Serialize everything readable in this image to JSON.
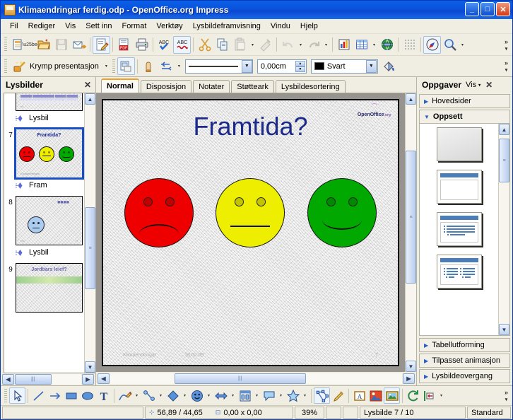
{
  "window": {
    "title": "Klimaendringar ferdig.odp - OpenOffice.org Impress",
    "app_icon": "impress-document-icon",
    "minimize_label": "_",
    "maximize_label": "□",
    "close_label": "✕"
  },
  "menu": {
    "items": [
      {
        "label": "Fil"
      },
      {
        "label": "Rediger"
      },
      {
        "label": "Vis"
      },
      {
        "label": "Sett inn"
      },
      {
        "label": "Format"
      },
      {
        "label": "Verktøy"
      },
      {
        "label": "Lysbildeframvisning"
      },
      {
        "label": "Vindu"
      },
      {
        "label": "Hjelp"
      }
    ]
  },
  "standard_toolbar": {
    "overflow_label": "»",
    "items": [
      {
        "name": "new-document-button",
        "icon": "new-document-icon",
        "dropdown": true
      },
      {
        "name": "open-button",
        "icon": "open-folder-icon"
      },
      {
        "name": "save-button",
        "icon": "floppy-save-icon",
        "disabled": true
      },
      {
        "name": "email-document-button",
        "icon": "envelope-arrow-icon"
      },
      {
        "name": "edit-file-button",
        "icon": "document-pencil-icon",
        "active": true
      },
      {
        "name": "export-pdf-button",
        "icon": "pdf-icon"
      },
      {
        "name": "print-button",
        "icon": "printer-icon"
      },
      {
        "name": "spelling-button",
        "icon": "abc-check-icon"
      },
      {
        "name": "autospellcheck-button",
        "icon": "abc-wave-icon",
        "active": true
      },
      {
        "name": "cut-button",
        "icon": "scissors-icon"
      },
      {
        "name": "copy-button",
        "icon": "copy-pages-icon"
      },
      {
        "name": "paste-button",
        "icon": "clipboard-icon",
        "dropdown": true,
        "disabled": true
      },
      {
        "name": "clone-formatting-button",
        "icon": "paintbrush-icon",
        "disabled": true
      },
      {
        "name": "undo-button",
        "icon": "undo-arrow-icon",
        "dropdown": true,
        "disabled": true
      },
      {
        "name": "redo-button",
        "icon": "redo-arrow-icon",
        "dropdown": true,
        "disabled": true
      },
      {
        "name": "insert-chart-button",
        "icon": "bar-chart-icon"
      },
      {
        "name": "insert-table-button",
        "icon": "table-grid-icon",
        "dropdown": true
      },
      {
        "name": "hyperlink-button",
        "icon": "globe-link-icon"
      },
      {
        "name": "display-grid-button",
        "icon": "dot-grid-icon"
      },
      {
        "name": "navigator-button",
        "icon": "compass-icon",
        "active": true
      },
      {
        "name": "zoom-button",
        "icon": "magnifier-icon",
        "dropdown": true
      }
    ]
  },
  "line_toolbar": {
    "overflow_label": "»",
    "shrink_label": "Krymp presentasjon",
    "shrink_icon": "wand-sparkle-icon",
    "slide_properties_icon": "slide-properties-icon",
    "point_edit_icon": "points-thumb-icon",
    "connector_icon": "connector-arrows-icon",
    "line_style_value": "——————",
    "line_width_value": "0,00cm",
    "line_color_value": "Svart",
    "line_color_hex": "#000000",
    "fill_icon": "paint-can-icon"
  },
  "slides_panel": {
    "title": "Lysbilder",
    "close_icon": "close-icon",
    "scroll_up_label": "▲",
    "scroll_down_label": "▼",
    "scroll_left_label": "‹",
    "scroll_right_label": "›",
    "slides": [
      {
        "number": "",
        "kind": "table",
        "caption": "Lysbil",
        "selected": false
      },
      {
        "number": "7",
        "kind": "faces",
        "title": "Framtida?",
        "caption": "Fram",
        "selected": true,
        "foot_left": "Klimaendringar",
        "foot_right": "7"
      },
      {
        "number": "8",
        "kind": "single-face",
        "title": "■■■■",
        "caption": "Lysbil",
        "selected": false
      },
      {
        "number": "9",
        "kind": "earth",
        "title": "Jordtiars leief?",
        "caption": "",
        "selected": false
      }
    ]
  },
  "view_tabs": {
    "tabs": [
      {
        "label": "Normal",
        "selected": true
      },
      {
        "label": "Disposisjon",
        "selected": false
      },
      {
        "label": "Notater",
        "selected": false
      },
      {
        "label": "Støtteark",
        "selected": false
      },
      {
        "label": "Lysbildesortering",
        "selected": false
      }
    ]
  },
  "slide": {
    "title": "Framtida?",
    "logo_text": "OpenOffice",
    "logo_suffix": ".org",
    "footer_left": "Klimaendringar",
    "footer_date": "18.02.09",
    "footer_page": "7",
    "faces": [
      {
        "name": "red-sad-face",
        "color": "#ee0000",
        "mood": "sad"
      },
      {
        "name": "yellow-neutral-face",
        "color": "#eeee00",
        "mood": "flat"
      },
      {
        "name": "green-happy-face",
        "color": "#00a800",
        "mood": "happy"
      }
    ]
  },
  "tasks_panel": {
    "title": "Oppgaver",
    "view_label": "Vis",
    "view_arrow": "▾",
    "close_icon": "close-icon",
    "sections": [
      {
        "label": "Hovedsider",
        "open": false
      },
      {
        "label": "Oppsett",
        "open": true
      },
      {
        "label": "Tabellutforming",
        "open": false
      },
      {
        "label": "Tilpasset animasjon",
        "open": false
      },
      {
        "label": "Lysbildeovergang",
        "open": false
      }
    ],
    "layouts": [
      {
        "name": "layout-blank",
        "kind": "blank"
      },
      {
        "name": "layout-title-content",
        "kind": "title-center"
      },
      {
        "name": "layout-title-bullets",
        "kind": "title-bullets"
      },
      {
        "name": "layout-title-two-content",
        "kind": "title-two"
      }
    ],
    "scroll_up_label": "▲",
    "scroll_down_label": "▼"
  },
  "drawing_toolbar": {
    "overflow_label": "»",
    "items": [
      {
        "name": "select-tool",
        "icon": "cursor-arrow-icon",
        "active": true
      },
      {
        "name": "line-tool",
        "icon": "line-icon"
      },
      {
        "name": "arrow-tool",
        "icon": "arrow-line-icon"
      },
      {
        "name": "rectangle-tool",
        "icon": "rectangle-icon"
      },
      {
        "name": "ellipse-tool",
        "icon": "ellipse-icon"
      },
      {
        "name": "text-tool",
        "icon": "text-t-icon"
      },
      {
        "name": "curve-tool",
        "icon": "pencil-curve-icon",
        "dropdown": true
      },
      {
        "name": "connector-tool",
        "icon": "connector-icon",
        "dropdown": true
      },
      {
        "name": "basic-shapes-tool",
        "icon": "diamond-shape-icon",
        "dropdown": true
      },
      {
        "name": "symbol-shapes-tool",
        "icon": "smiley-shape-icon",
        "dropdown": true
      },
      {
        "name": "block-arrows-tool",
        "icon": "block-arrow-icon",
        "dropdown": true
      },
      {
        "name": "flowchart-tool",
        "icon": "flowchart-icon",
        "dropdown": true
      },
      {
        "name": "callouts-tool",
        "icon": "callout-bubble-icon",
        "dropdown": true
      },
      {
        "name": "stars-tool",
        "icon": "star-shape-icon",
        "dropdown": true
      },
      {
        "name": "points-tool",
        "icon": "edit-points-icon",
        "active": true
      },
      {
        "name": "glue-points-tool",
        "icon": "glue-point-icon"
      },
      {
        "name": "fontwork-tool",
        "icon": "fontwork-icon"
      },
      {
        "name": "from-file-tool",
        "icon": "insert-image-icon"
      },
      {
        "name": "gallery-tool",
        "icon": "gallery-icon",
        "active": true
      },
      {
        "name": "rotate-tool",
        "icon": "rotate-icon"
      },
      {
        "name": "alignment-tool",
        "icon": "align-icon",
        "dropdown": true
      }
    ]
  },
  "status_bar": {
    "info": "",
    "cursor_icon": "crosshair-icon",
    "cursor_position": "56,89 / 44,65",
    "size_icon": "selection-size-icon",
    "object_size": "0,00 x 0,00",
    "zoom": "39%",
    "mod1": "",
    "mod2": "",
    "slide_indicator": "Lysbilde 7 / 10",
    "master_page": "Standard"
  }
}
